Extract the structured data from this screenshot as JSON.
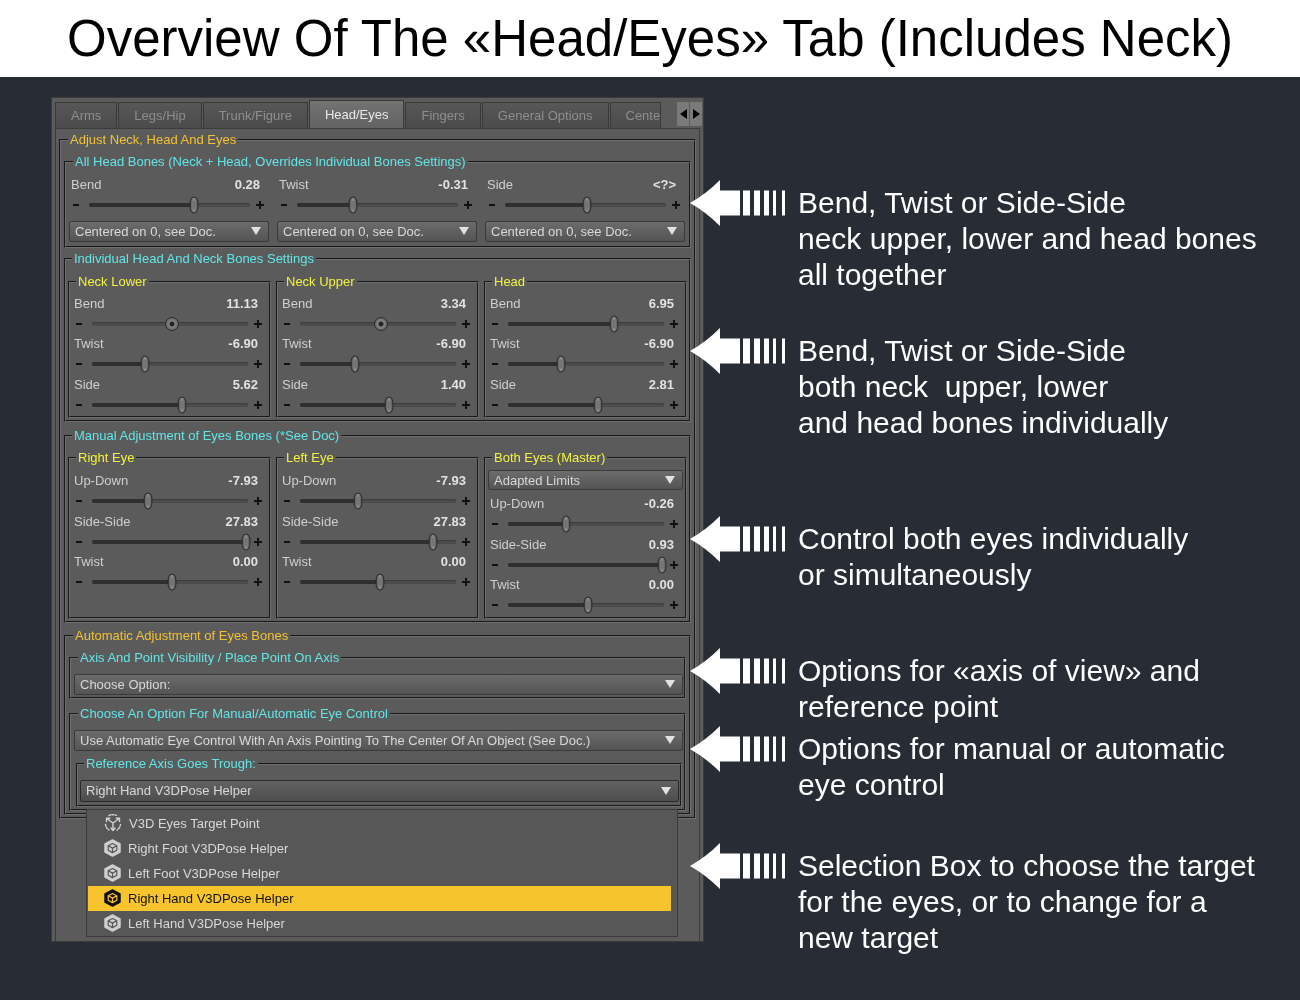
{
  "title": "Overview Of The «Head/Eyes» Tab (Includes Neck)",
  "panel": {
    "tabs": [
      {
        "label": "Arms",
        "selected": false
      },
      {
        "label": "Legs/Hip",
        "selected": false
      },
      {
        "label": "Trunk/Figure",
        "selected": false
      },
      {
        "label": "Head/Eyes",
        "selected": true
      },
      {
        "label": "Fingers",
        "selected": false
      },
      {
        "label": "General Options",
        "selected": false
      },
      {
        "label": "Cente",
        "selected": false
      }
    ],
    "adjust_group": {
      "title": "Adjust Neck, Head And Eyes",
      "all_head_bones": {
        "title": "All Head Bones (Neck + Head, Overrides Individual Bones Settings)",
        "columns": [
          {
            "slider": {
              "label": "Bend",
              "value": "0.28",
              "level": 0.65,
              "kind": "standard"
            },
            "dropdown": {
              "value": "Centered on 0, see Doc."
            }
          },
          {
            "slider": {
              "label": "Twist",
              "value": "-0.31",
              "level": 0.35,
              "kind": "standard"
            },
            "dropdown": {
              "value": "Centered on 0, see Doc."
            }
          },
          {
            "slider": {
              "label": "Side",
              "value": "<?>",
              "level": 0.51,
              "kind": "standard"
            },
            "dropdown": {
              "value": "Centered on 0, see Doc."
            }
          }
        ]
      },
      "individual_bones": {
        "title": "Individual Head And Neck Bones Settings",
        "parts": [
          {
            "title": "Neck Lower",
            "sliders": [
              {
                "label": "Bend",
                "value": "11.13",
                "level": 0.51,
                "kind": "centered"
              },
              {
                "label": "Twist",
                "value": "-6.90",
                "level": 0.34,
                "kind": "standard"
              },
              {
                "label": "Side",
                "value": "5.62",
                "level": 0.58,
                "kind": "standard"
              }
            ]
          },
          {
            "title": "Neck Upper",
            "sliders": [
              {
                "label": "Bend",
                "value": "3.34",
                "level": 0.52,
                "kind": "centered"
              },
              {
                "label": "Twist",
                "value": "-6.90",
                "level": 0.35,
                "kind": "standard"
              },
              {
                "label": "Side",
                "value": "1.40",
                "level": 0.57,
                "kind": "standard"
              }
            ]
          },
          {
            "title": "Head",
            "sliders": [
              {
                "label": "Bend",
                "value": "6.95",
                "level": 0.68,
                "kind": "standard"
              },
              {
                "label": "Twist",
                "value": "-6.90",
                "level": 0.34,
                "kind": "standard"
              },
              {
                "label": "Side",
                "value": "2.81",
                "level": 0.58,
                "kind": "standard"
              }
            ]
          }
        ]
      },
      "manual_eyes": {
        "title": "Manual Adjustment of Eyes Bones (*See Doc)",
        "parts": [
          {
            "title": "Right Eye",
            "sliders": [
              {
                "label": "Up-Down",
                "value": "-7.93",
                "level": 0.36,
                "kind": "standard"
              },
              {
                "label": "Side-Side",
                "value": "27.83",
                "level": 0.99,
                "kind": "standard"
              },
              {
                "label": "Twist",
                "value": "0.00",
                "level": 0.51,
                "kind": "standard"
              }
            ]
          },
          {
            "title": "Left Eye",
            "sliders": [
              {
                "label": "Up-Down",
                "value": "-7.93",
                "level": 0.37,
                "kind": "standard"
              },
              {
                "label": "Side-Side",
                "value": "27.83",
                "level": 0.85,
                "kind": "standard"
              },
              {
                "label": "Twist",
                "value": "0.00",
                "level": 0.51,
                "kind": "standard"
              }
            ]
          },
          {
            "title": "Both Eyes (Master)",
            "dropdown": {
              "value": "Adapted Limits"
            },
            "sliders": [
              {
                "label": "Up-Down",
                "value": "-0.26",
                "level": 0.37,
                "kind": "standard"
              },
              {
                "label": "Side-Side",
                "value": "0.93",
                "level": 0.99,
                "kind": "standard"
              },
              {
                "label": "Twist",
                "value": "0.00",
                "level": 0.51,
                "kind": "standard"
              }
            ]
          }
        ]
      },
      "automatic_eyes": {
        "title": "Automatic Adjustment of Eyes Bones",
        "axis_visibility": {
          "title": "Axis And Point Visibility / Place Point On Axis",
          "dropdown": {
            "value": "Choose Option:"
          }
        },
        "eye_control": {
          "title": "Choose An Option For Manual/Automatic Eye Control",
          "dropdown": {
            "value": "Use Automatic Eye Control With An Axis Pointing To The Center Of An Object (See Doc.)"
          },
          "reference_axis": {
            "title": "Reference Axis Goes Trough:",
            "dropdown": {
              "value": "Right Hand V3DPose Helper",
              "expanded": true,
              "options": [
                {
                  "label": "V3D Eyes Target Point",
                  "kind": "target",
                  "selected": false
                },
                {
                  "label": "Right Foot V3DPose Helper",
                  "kind": "helper",
                  "selected": false
                },
                {
                  "label": "Left Foot V3DPose Helper",
                  "kind": "helper",
                  "selected": false
                },
                {
                  "label": "Right Hand V3DPose Helper",
                  "kind": "helper",
                  "selected": true
                },
                {
                  "label": "Left Hand V3DPose Helper",
                  "kind": "helper",
                  "selected": false
                }
              ]
            }
          }
        }
      }
    }
  },
  "callouts": [
    {
      "lines": [
        "Bend, Twist or Side-Side",
        "neck upper, lower and head bones",
        "all together"
      ]
    },
    {
      "lines": [
        "Bend, Twist or Side-Side",
        "both neck  upper, lower",
        "and head bones individually"
      ]
    },
    {
      "lines": [
        "Control both eyes individually",
        "or simultaneously"
      ]
    },
    {
      "lines": [
        "Options for «axis of view» and",
        "reference point"
      ]
    },
    {
      "lines": [
        "Options for manual or automatic",
        "eye control"
      ]
    },
    {
      "lines": [
        "Selection Box to choose the target",
        "for the eyes, or to change for a",
        "new target"
      ]
    }
  ]
}
